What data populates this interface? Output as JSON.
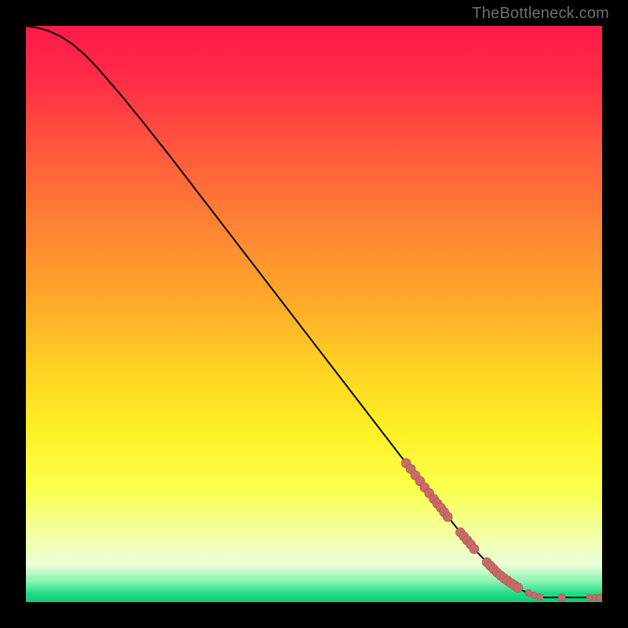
{
  "attribution": "TheBottleneck.com",
  "colors": {
    "frame": "#000000",
    "curve": "#000000",
    "marker_fill": "#c86a68",
    "marker_stroke": "#a85250",
    "gradient_stops": [
      {
        "offset": 0.0,
        "color": "#ff1a4b"
      },
      {
        "offset": 0.1,
        "color": "#ff2e45"
      },
      {
        "offset": 0.22,
        "color": "#ff5a3c"
      },
      {
        "offset": 0.35,
        "color": "#ff8433"
      },
      {
        "offset": 0.48,
        "color": "#ffaa2a"
      },
      {
        "offset": 0.6,
        "color": "#ffd423"
      },
      {
        "offset": 0.7,
        "color": "#ffef25"
      },
      {
        "offset": 0.8,
        "color": "#fbff4a"
      },
      {
        "offset": 0.88,
        "color": "#f3ffa0"
      },
      {
        "offset": 0.935,
        "color": "#eaffd8"
      },
      {
        "offset": 0.965,
        "color": "#86f3b0"
      },
      {
        "offset": 0.985,
        "color": "#1fdc87"
      },
      {
        "offset": 1.0,
        "color": "#18c87c"
      }
    ]
  },
  "chart_data": {
    "type": "line",
    "title": "",
    "xlabel": "",
    "ylabel": "",
    "xlim": [
      0,
      100
    ],
    "ylim": [
      0,
      100
    ],
    "grid": false,
    "legend": null,
    "curve": [
      {
        "x": 0,
        "y": 100.0
      },
      {
        "x": 2,
        "y": 99.7
      },
      {
        "x": 4,
        "y": 99.1
      },
      {
        "x": 6,
        "y": 98.2
      },
      {
        "x": 8,
        "y": 96.9
      },
      {
        "x": 10,
        "y": 95.2
      },
      {
        "x": 12,
        "y": 93.2
      },
      {
        "x": 14,
        "y": 90.9
      },
      {
        "x": 17,
        "y": 87.4
      },
      {
        "x": 20,
        "y": 83.7
      },
      {
        "x": 25,
        "y": 77.4
      },
      {
        "x": 30,
        "y": 70.9
      },
      {
        "x": 35,
        "y": 64.4
      },
      {
        "x": 40,
        "y": 57.9
      },
      {
        "x": 45,
        "y": 51.4
      },
      {
        "x": 50,
        "y": 44.9
      },
      {
        "x": 55,
        "y": 38.4
      },
      {
        "x": 60,
        "y": 31.9
      },
      {
        "x": 65,
        "y": 25.4
      },
      {
        "x": 70,
        "y": 18.9
      },
      {
        "x": 75,
        "y": 12.6
      },
      {
        "x": 78,
        "y": 9.0
      },
      {
        "x": 81,
        "y": 5.9
      },
      {
        "x": 84,
        "y": 3.4
      },
      {
        "x": 86,
        "y": 2.1
      },
      {
        "x": 88,
        "y": 1.2
      },
      {
        "x": 90,
        "y": 0.8
      },
      {
        "x": 92,
        "y": 0.8
      },
      {
        "x": 94,
        "y": 0.8
      },
      {
        "x": 96,
        "y": 0.8
      },
      {
        "x": 98,
        "y": 0.8
      },
      {
        "x": 100,
        "y": 0.8
      }
    ],
    "markers": [
      {
        "x": 66.0,
        "y": 24.1,
        "r": 1.0
      },
      {
        "x": 66.8,
        "y": 23.1,
        "r": 1.0
      },
      {
        "x": 67.6,
        "y": 22.0,
        "r": 1.0
      },
      {
        "x": 68.4,
        "y": 21.0,
        "r": 1.0
      },
      {
        "x": 69.2,
        "y": 19.9,
        "r": 1.0
      },
      {
        "x": 70.0,
        "y": 18.9,
        "r": 1.0
      },
      {
        "x": 70.8,
        "y": 17.9,
        "r": 1.0
      },
      {
        "x": 71.4,
        "y": 17.1,
        "r": 1.0
      },
      {
        "x": 72.0,
        "y": 16.4,
        "r": 1.0
      },
      {
        "x": 72.6,
        "y": 15.6,
        "r": 1.0
      },
      {
        "x": 73.2,
        "y": 14.8,
        "r": 1.0
      },
      {
        "x": 75.4,
        "y": 12.1,
        "r": 1.0
      },
      {
        "x": 76.0,
        "y": 11.4,
        "r": 1.0
      },
      {
        "x": 76.6,
        "y": 10.7,
        "r": 1.0
      },
      {
        "x": 77.2,
        "y": 10.0,
        "r": 1.0
      },
      {
        "x": 77.8,
        "y": 9.2,
        "r": 1.0
      },
      {
        "x": 80.0,
        "y": 6.9,
        "r": 1.0
      },
      {
        "x": 80.6,
        "y": 6.3,
        "r": 1.0
      },
      {
        "x": 81.2,
        "y": 5.7,
        "r": 1.0
      },
      {
        "x": 81.8,
        "y": 5.1,
        "r": 1.0
      },
      {
        "x": 82.4,
        "y": 4.6,
        "r": 1.0
      },
      {
        "x": 83.0,
        "y": 4.1,
        "r": 1.0
      },
      {
        "x": 83.6,
        "y": 3.7,
        "r": 1.0
      },
      {
        "x": 84.2,
        "y": 3.3,
        "r": 1.0
      },
      {
        "x": 84.8,
        "y": 2.9,
        "r": 1.0
      },
      {
        "x": 85.4,
        "y": 2.5,
        "r": 1.0
      },
      {
        "x": 87.2,
        "y": 1.6,
        "r": 0.7
      },
      {
        "x": 88.2,
        "y": 1.2,
        "r": 0.7
      },
      {
        "x": 89.2,
        "y": 0.9,
        "r": 0.7
      },
      {
        "x": 93.0,
        "y": 0.8,
        "r": 0.8
      },
      {
        "x": 97.8,
        "y": 0.8,
        "r": 0.7
      },
      {
        "x": 98.8,
        "y": 0.8,
        "r": 0.7
      },
      {
        "x": 99.6,
        "y": 0.8,
        "r": 0.7
      }
    ]
  }
}
